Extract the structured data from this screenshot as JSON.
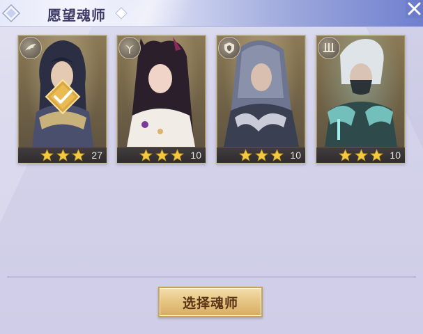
{
  "header": {
    "title": "愿望魂师",
    "close_icon": "close-x-icon"
  },
  "cards": [
    {
      "name": "soul-master-card-1",
      "stars": 3,
      "level": "27",
      "badge_icon": "wing-icon",
      "selected": true
    },
    {
      "name": "soul-master-card-2",
      "stars": 3,
      "level": "10",
      "badge_icon": "flower-icon",
      "selected": false
    },
    {
      "name": "soul-master-card-3",
      "stars": 3,
      "level": "10",
      "badge_icon": "shield-icon",
      "selected": false
    },
    {
      "name": "soul-master-card-4",
      "stars": 3,
      "level": "10",
      "badge_icon": "swords-icon",
      "selected": false
    }
  ],
  "actions": {
    "select_label": "选择魂师"
  },
  "colors": {
    "star": "#f3c93f",
    "button_gold": "#e7c685",
    "title_text": "#3e3b67"
  }
}
